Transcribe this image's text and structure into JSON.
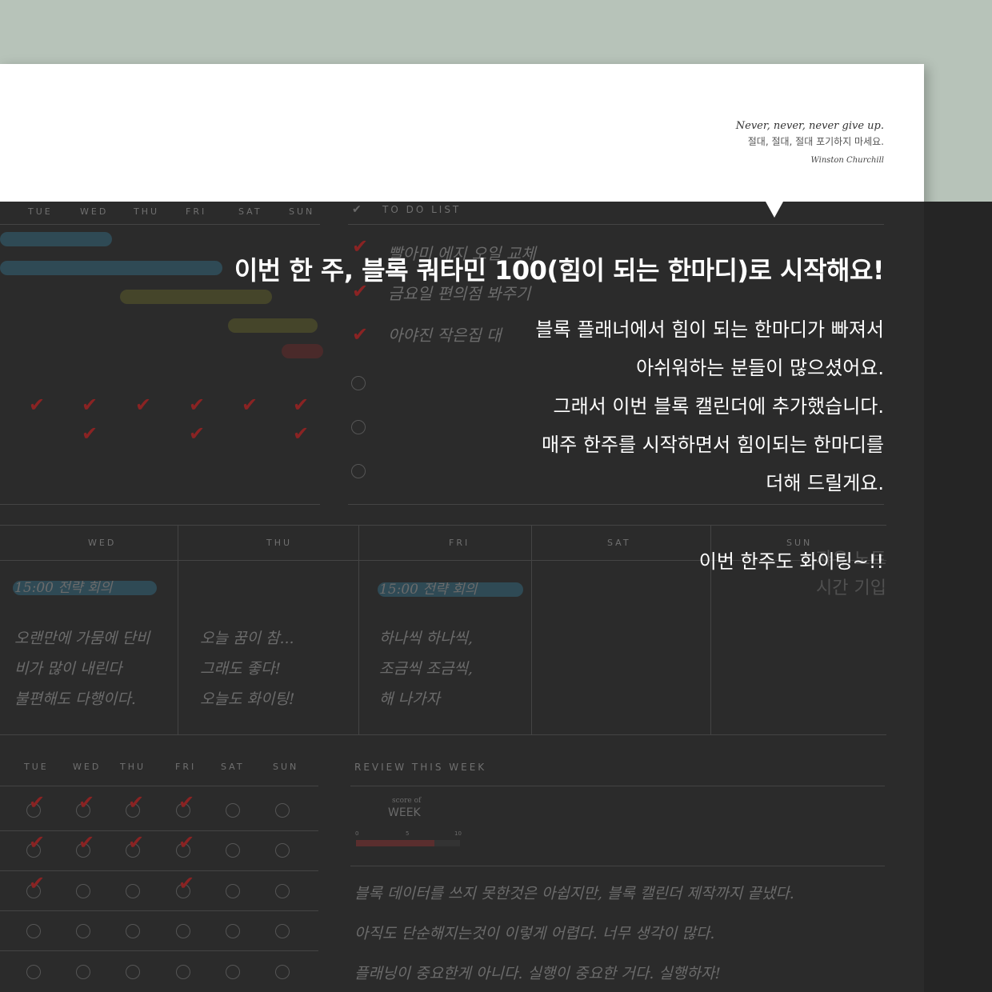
{
  "quote": {
    "english": "Never, never, never give up.",
    "korean": "절대, 절대, 절대 포기하지 마세요.",
    "author": "Winston Churchill"
  },
  "planner": {
    "weekday_headers_top": [
      "TUE",
      "WED",
      "THU",
      "FRI",
      "SAT",
      "SUN"
    ],
    "todo_title": "TO DO LIST",
    "todo_items": [
      "빨아미 에지 오일 교체",
      "금요일 편의점 봐주기",
      "아야진 작은집 대"
    ],
    "free_note_lines": [
      "자유 노트",
      "시간 기입"
    ],
    "diary_headers": [
      "WED",
      "THU",
      "FRI",
      "SAT",
      "SUN"
    ],
    "meeting_label": "15:00 전략 회의",
    "diary_wed": [
      "오랜만에 가뭄에 단비",
      "비가 많이 내린다",
      "불편해도 다행이다."
    ],
    "diary_thu": [
      "오늘 꿈이 참...",
      "그래도 좋다!",
      "오늘도 화이팅!"
    ],
    "diary_fri": [
      "하나씩 하나씩,",
      "조금씩 조금씩,",
      "해 나가자"
    ],
    "habit_headers": [
      "TUE",
      "WED",
      "THU",
      "FRI",
      "SAT",
      "SUN"
    ],
    "review_title": "REVIEW THIS WEEK",
    "score_label_small": "score of",
    "score_label_big": "WEEK",
    "score_ticks": [
      "0",
      "5",
      "10"
    ],
    "score_value_fraction": 0.75,
    "review_lines": [
      "블록 데이터를 쓰지 못한것은 아쉽지만, 블록 캘린더 제작까지 끝냈다.",
      "아직도 단순해지는것이 이렇게 어렵다. 너무 생각이 많다.",
      "플래닝이 중요한게 아니다. 실행이 중요한 거다. 실행하자!"
    ]
  },
  "announcement": {
    "title": "이번 한 주, 블록 쿼타민 100(힘이 되는 한마디)로 시작해요!",
    "body_lines": [
      "블록 플래너에서 힘이 되는 한마디가 빠져서",
      "아쉬워하는 분들이 많으셨어요.",
      "그래서 이번 블록 캘린더에 추가했습니다.",
      "매주 한주를 시작하면서 힘이되는 한마디를",
      "더해 드릴게요."
    ],
    "cheer": "이번 한주도 화이팅~!!"
  },
  "colors": {
    "background": "#b7c3b9",
    "overlay": "#2b2b2b",
    "check": "#8a2323"
  }
}
